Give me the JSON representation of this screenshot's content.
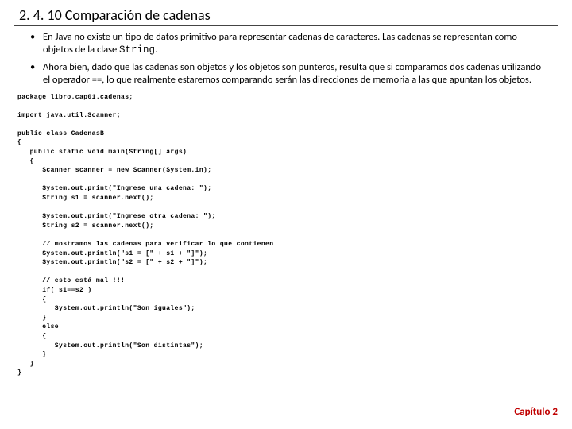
{
  "title": "2. 4. 10 Comparación de cadenas",
  "bullets": [
    {
      "pre": "En Java no existe un tipo de datos primitivo para representar cadenas de caracteres. Las cadenas se representan como objetos de la clase ",
      "code": "String",
      "post": "."
    },
    {
      "pre": "Ahora bien, dado que las cadenas son objetos y los objetos son punteros, resulta que si comparamos dos cadenas utilizando el operador ==, lo que realmente estaremos comparando serán las direcciones de memoria a las que apuntan los objetos.",
      "code": "",
      "post": ""
    }
  ],
  "code": "package libro.cap01.cadenas;\n\nimport java.util.Scanner;\n\npublic class CadenasB\n{\n   public static void main(String[] args)\n   {\n      Scanner scanner = new Scanner(System.in);\n\n      System.out.print(\"Ingrese una cadena: \");\n      String s1 = scanner.next();\n\n      System.out.print(\"Ingrese otra cadena: \");\n      String s2 = scanner.next();\n\n      // mostramos las cadenas para verificar lo que contienen\n      System.out.println(\"s1 = [\" + s1 + \"]\");\n      System.out.println(\"s2 = [\" + s2 + \"]\");\n\n      // esto está mal !!!\n      if( s1==s2 )\n      {\n         System.out.println(\"Son iguales\");\n      }\n      else\n      {\n         System.out.println(\"Son distintas\");\n      }\n   }\n}",
  "chapter": "Capítulo 2"
}
